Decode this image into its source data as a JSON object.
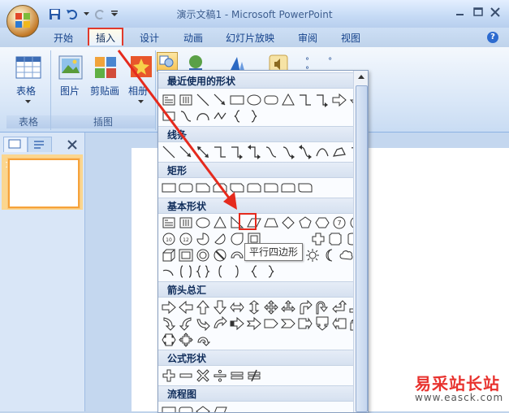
{
  "window": {
    "title": "演示文稿1 - Microsoft PowerPoint"
  },
  "tabs": [
    {
      "label": "开始"
    },
    {
      "label": "插入"
    },
    {
      "label": "设计"
    },
    {
      "label": "动画"
    },
    {
      "label": "幻灯片放映"
    },
    {
      "label": "审阅"
    },
    {
      "label": "视图"
    }
  ],
  "ribbon": {
    "table_label": "表格",
    "table_group": "表格",
    "picture_label": "图片",
    "clipart_label": "剪贴画",
    "album_label": "相册",
    "illus_group": "插图"
  },
  "dropdown": {
    "categories": {
      "recent": "最近使用的形状",
      "lines": "线条",
      "rect": "矩形",
      "basic": "基本形状",
      "arrows": "箭头总汇",
      "equation": "公式形状",
      "flowchart": "流程图"
    },
    "tooltip": "平行四边形"
  },
  "slides": {
    "thumb_number": "1"
  },
  "watermark": {
    "cn": "易采站长站",
    "url": "www.easck.com"
  },
  "colors": {
    "accent_red": "#e03a2c",
    "ribbon_blue": "#15428b"
  }
}
